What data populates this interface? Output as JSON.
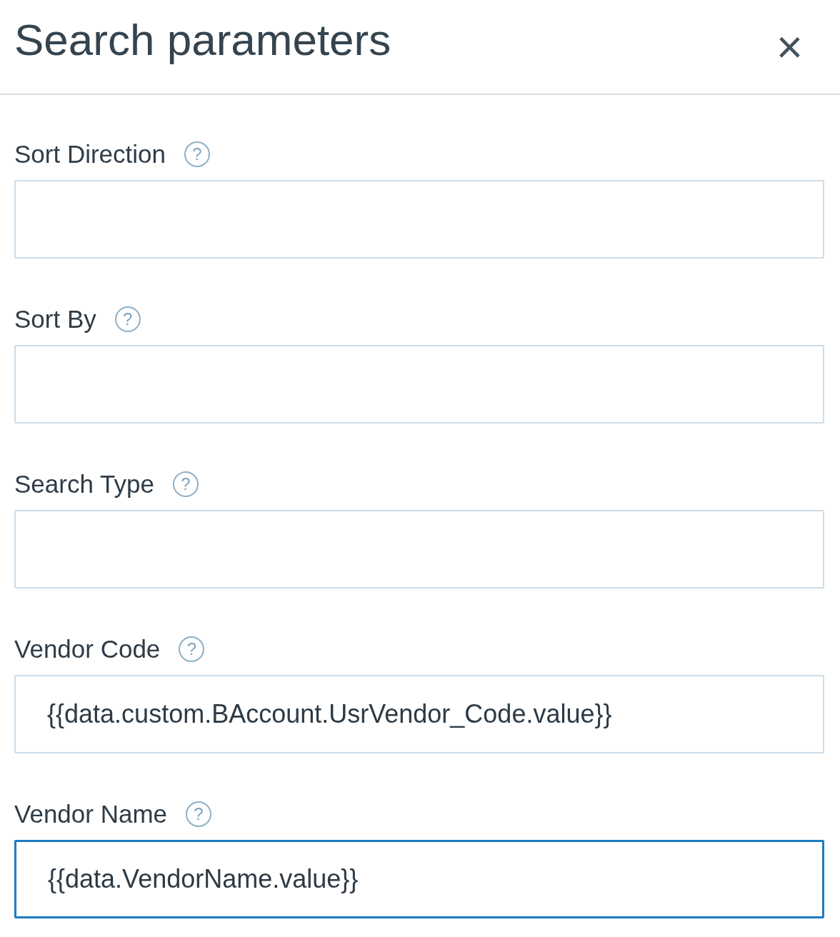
{
  "panel": {
    "title": "Search parameters",
    "close": "×"
  },
  "fields": [
    {
      "label": "Sort Direction",
      "help": "?",
      "focused": false
    },
    {
      "label": "Sort By",
      "help": "?",
      "focused": false
    },
    {
      "label": "Search Type",
      "help": "?",
      "focused": false
    },
    {
      "label": "Vendor Code",
      "help": "?",
      "value": "{{data.custom.BAccount.UsrVendor_Code.value}}",
      "focused": false
    },
    {
      "label": "Vendor Name",
      "help": "?",
      "value": "{{data.VendorName.value}}",
      "focused": true
    }
  ]
}
